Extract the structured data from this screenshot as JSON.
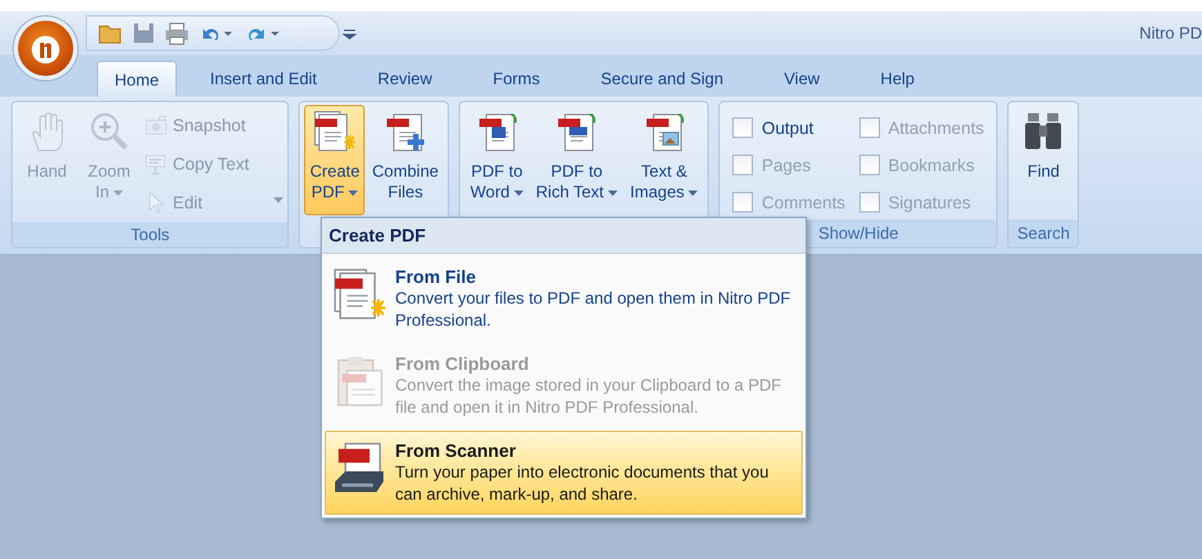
{
  "window": {
    "title": "Nitro PD"
  },
  "tabs": [
    {
      "label": "Home",
      "selected": true
    },
    {
      "label": "Insert and Edit",
      "selected": false
    },
    {
      "label": "Review",
      "selected": false
    },
    {
      "label": "Forms",
      "selected": false
    },
    {
      "label": "Secure and Sign",
      "selected": false
    },
    {
      "label": "View",
      "selected": false
    },
    {
      "label": "Help",
      "selected": false
    }
  ],
  "groups": [
    {
      "label": "Tools",
      "kind": "tools",
      "large": [
        {
          "lines": [
            "Hand"
          ],
          "dropdown": false,
          "disabled": true,
          "selected": false
        },
        {
          "lines": [
            "Zoom",
            "In"
          ],
          "dropdown": true,
          "disabled": true,
          "selected": false
        }
      ],
      "small": [
        {
          "label": "Snapshot",
          "disabled": true
        },
        {
          "label": "Copy Text",
          "disabled": true
        },
        {
          "label": "Edit",
          "disabled": true
        }
      ]
    },
    {
      "kind": "buttons",
      "large": [
        {
          "lines": [
            "Create",
            "PDF"
          ],
          "dropdown": true,
          "disabled": false,
          "selected": true
        },
        {
          "lines": [
            "Combine",
            "Files"
          ],
          "dropdown": false,
          "disabled": false,
          "selected": false
        }
      ]
    },
    {
      "kind": "buttons",
      "large": [
        {
          "lines": [
            "PDF to",
            "Word"
          ],
          "dropdown": true,
          "disabled": false,
          "selected": false
        },
        {
          "lines": [
            "PDF to",
            "Rich Text"
          ],
          "dropdown": true,
          "disabled": false,
          "selected": false
        },
        {
          "lines": [
            "Text &",
            "Images"
          ],
          "dropdown": true,
          "disabled": false,
          "selected": false
        }
      ]
    },
    {
      "label": "Show/Hide",
      "kind": "checks",
      "checks": [
        {
          "label": "Output",
          "checked": false,
          "disabled": false
        },
        {
          "label": "Attachments",
          "checked": false,
          "disabled": true
        },
        {
          "label": "Pages",
          "checked": false,
          "disabled": true
        },
        {
          "label": "Bookmarks",
          "checked": false,
          "disabled": true
        },
        {
          "label": "Comments",
          "checked": false,
          "disabled": true
        },
        {
          "label": "Signatures",
          "checked": false,
          "disabled": true
        }
      ]
    },
    {
      "label": "Search",
      "kind": "buttons",
      "large": [
        {
          "lines": [
            "Find"
          ],
          "dropdown": false,
          "disabled": false,
          "selected": false
        }
      ]
    }
  ],
  "menu": {
    "title": "Create PDF",
    "items": [
      {
        "title": "From File",
        "description": "Convert your files to PDF and open them in Nitro PDF Professional.",
        "disabled": false,
        "selected": false
      },
      {
        "title": "From Clipboard",
        "description": "Convert the image stored in your Clipboard to a PDF file and open it in Nitro PDF Professional.",
        "disabled": true,
        "selected": false
      },
      {
        "title": "From Scanner",
        "description": "Turn your paper into electronic documents  that you can archive, mark-up, and share.",
        "disabled": false,
        "selected": true
      }
    ]
  }
}
